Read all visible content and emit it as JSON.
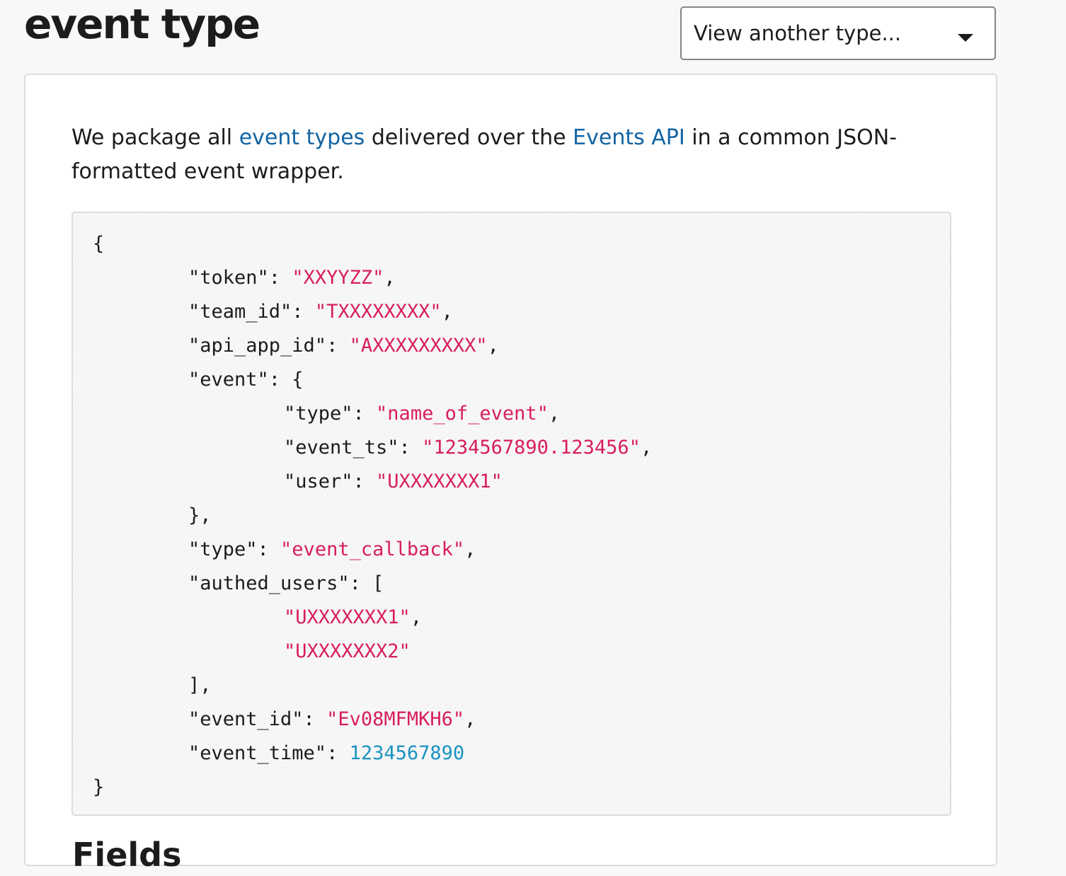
{
  "header": {
    "title": "event type",
    "type_select": {
      "value": "View another type...",
      "icon": "caret-down-icon"
    }
  },
  "intro": {
    "before_link1": "We package all ",
    "link1": "event types",
    "between_links": " delivered over the ",
    "link2": "Events API",
    "after_link2": " in a common JSON-formatted event wrapper."
  },
  "code": {
    "open_brace": "{",
    "token_key": "\"token\": ",
    "token_value": "\"XXYYZZ\"",
    "team_id_key": "\"team_id\": ",
    "team_id_value": "\"TXXXXXXXX\"",
    "api_app_id_key": "\"api_app_id\": ",
    "api_app_id_value": "\"AXXXXXXXXX\"",
    "event_key": "\"event\": {",
    "event_type_key": "\"type\": ",
    "event_type_value": "\"name_of_event\"",
    "event_ts_key": "\"event_ts\": ",
    "event_ts_value": "\"1234567890.123456\"",
    "user_key": "\"user\": ",
    "user_value": "\"UXXXXXXX1\"",
    "event_close": "},",
    "type_key": "\"type\": ",
    "type_value": "\"event_callback\"",
    "authed_users_key": "\"authed_users\": [",
    "authed_user_1": "\"UXXXXXXX1\"",
    "authed_user_2": "\"UXXXXXXX2\"",
    "authed_users_close": "],",
    "event_id_key": "\"event_id\": ",
    "event_id_value": "\"Ev08MFMKH6\"",
    "event_time_key": "\"event_time\": ",
    "event_time_value": "1234567890",
    "close_brace": "}",
    "comma": ","
  },
  "next_section": {
    "heading": "Fields"
  },
  "colors": {
    "link": "#1264a3",
    "string": "#d81d5e",
    "number": "#1a93c2",
    "text": "#1d1c1d"
  }
}
